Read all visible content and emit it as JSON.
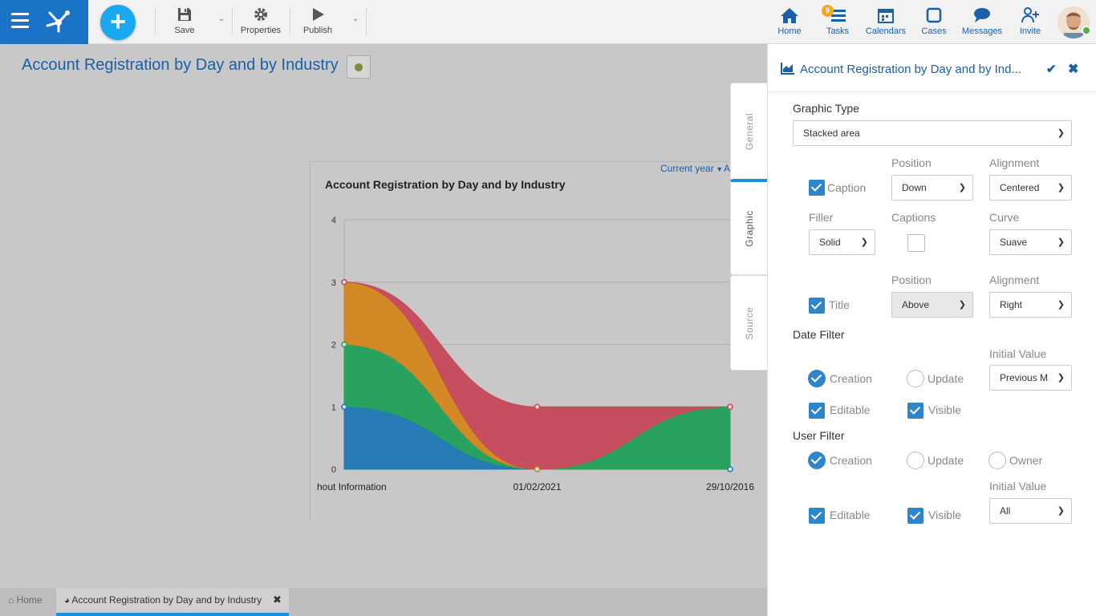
{
  "toolbar": {
    "save_label": "Save",
    "properties_label": "Properties",
    "publish_label": "Publish"
  },
  "nav": {
    "home": "Home",
    "tasks": "Tasks",
    "tasks_badge": "9",
    "calendars": "Calendars",
    "cases": "Cases",
    "messages": "Messages",
    "invite": "Invite"
  },
  "page": {
    "title": "Account Registration by Day and by Industry"
  },
  "chart_filter": {
    "period": "Current year",
    "extra": "A"
  },
  "chart_data": {
    "type": "area",
    "title": "Account Registration by Day and by Industry",
    "categories": [
      "hout Information",
      "01/02/2021",
      "29/10/2016"
    ],
    "yticks": [
      "0",
      "1",
      "2",
      "3",
      "4"
    ],
    "ylim": [
      0,
      4
    ],
    "stacked": true,
    "curve": "smooth",
    "series": [
      {
        "color": "#1f77b4",
        "values": [
          1,
          0,
          0
        ]
      },
      {
        "color": "#22a05a",
        "values": [
          1,
          0,
          1
        ]
      },
      {
        "color": "#d4861e",
        "values": [
          1,
          0,
          0
        ]
      },
      {
        "color": "#c6495a",
        "values": [
          0,
          1,
          0
        ]
      }
    ]
  },
  "bottom_tabs": {
    "home": "Home",
    "active": "Account Registration by Day and by Industry"
  },
  "side_tabs": {
    "general": "General",
    "graphic": "Graphic",
    "source": "Source"
  },
  "panel": {
    "title": "Account Registration by Day and by Ind...",
    "graphic_type_label": "Graphic Type",
    "graphic_type_value": "Stacked area",
    "position_label": "Position",
    "alignment_label": "Alignment",
    "caption_label": "Caption",
    "caption_position": "Down",
    "caption_alignment": "Centered",
    "filler_label": "Filler",
    "filler_value": "Solid",
    "captions_label": "Captions",
    "curve_label": "Curve",
    "curve_value": "Suave",
    "position2_label": "Position",
    "alignment2_label": "Alignment",
    "title_label": "Title",
    "title_position": "Above",
    "title_alignment": "Right",
    "date_filter_label": "Date Filter",
    "initial_value_label": "Initial Value",
    "date_creation": "Creation",
    "date_update": "Update",
    "date_initial_value": "Previous M",
    "date_editable": "Editable",
    "date_visible": "Visible",
    "user_filter_label": "User Filter",
    "user_creation": "Creation",
    "user_update": "Update",
    "user_owner": "Owner",
    "user_initial_value_label": "Initial Value",
    "user_initial_value": "All",
    "user_editable": "Editable",
    "user_visible": "Visible"
  }
}
